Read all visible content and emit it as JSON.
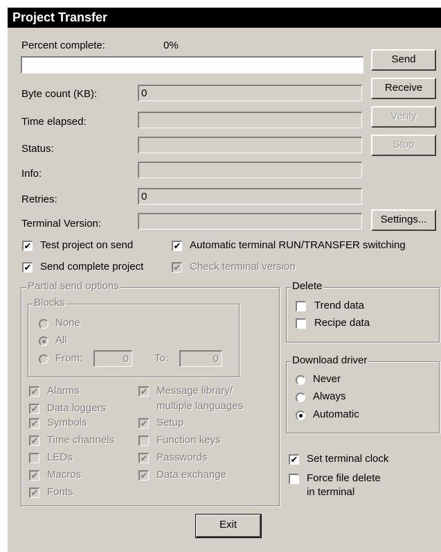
{
  "window": {
    "title": "Project Transfer"
  },
  "progress": {
    "label": "Percent complete:",
    "percent_text": "0%",
    "fraction": 0
  },
  "fields": {
    "byte_count": {
      "label": "Byte count (KB):",
      "value": "0"
    },
    "time_elapsed": {
      "label": "Time elapsed:",
      "value": ""
    },
    "status": {
      "label": "Status:",
      "value": ""
    },
    "info": {
      "label": "Info:",
      "value": ""
    },
    "retries": {
      "label": "Retries:",
      "value": "0"
    },
    "terminal_version": {
      "label": "Terminal Version:",
      "value": ""
    }
  },
  "buttons": {
    "send": "Send",
    "receive": "Receive",
    "verify": "Verify",
    "stop": "Stop",
    "settings": "Settings...",
    "exit": "Exit"
  },
  "options": {
    "test_project": {
      "label": "Test project on send",
      "checked": true
    },
    "auto_switch": {
      "label": "Automatic terminal RUN/TRANSFER switching",
      "checked": true
    },
    "send_complete": {
      "label": "Send complete project",
      "checked": true
    },
    "check_version": {
      "label": "Check terminal version",
      "checked": true,
      "disabled": true
    }
  },
  "partial": {
    "title": "Partial send options",
    "blocks": {
      "title": "Blocks",
      "none": "None",
      "all": "All",
      "from": "From:",
      "from_value": "0",
      "to": "To:",
      "to_value": "0",
      "selected": "All"
    },
    "items": {
      "alarms": {
        "label": "Alarms",
        "checked": true
      },
      "data_loggers": {
        "label": "Data loggers",
        "checked": true
      },
      "symbols": {
        "label": "Symbols",
        "checked": true
      },
      "time_channels": {
        "label": "Time channels",
        "checked": true
      },
      "leds": {
        "label": "LEDs",
        "checked": false
      },
      "macros": {
        "label": "Macros",
        "checked": true
      },
      "fonts": {
        "label": "Fonts",
        "checked": true
      },
      "message_library_1": {
        "label": "Message library/",
        "checked": true
      },
      "message_library_2": {
        "label": "multiple languages"
      },
      "setup": {
        "label": "Setup",
        "checked": true
      },
      "function_keys": {
        "label": "Function keys",
        "checked": false
      },
      "passwords": {
        "label": "Passwords",
        "checked": true
      },
      "data_exchange": {
        "label": "Data exchange",
        "checked": true
      }
    }
  },
  "delete": {
    "title": "Delete",
    "trend": {
      "label": "Trend data",
      "checked": false
    },
    "recipe": {
      "label": "Recipe data",
      "checked": false
    }
  },
  "download_driver": {
    "title": "Download driver",
    "never": "Never",
    "always": "Always",
    "automatic": "Automatic",
    "selected": "Automatic"
  },
  "clock": {
    "label": "Set terminal clock",
    "checked": true
  },
  "force_delete": {
    "label_1": "Force file delete",
    "label_2": "in terminal",
    "checked": false
  },
  "check_glyph": "✔"
}
